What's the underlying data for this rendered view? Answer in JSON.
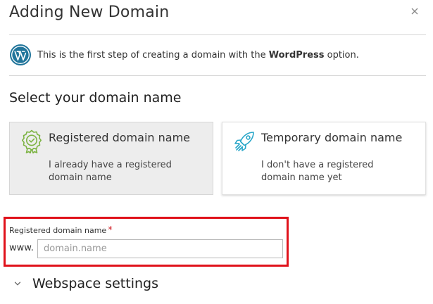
{
  "dialog": {
    "title": "Adding New Domain",
    "close_label": "×"
  },
  "info": {
    "text_before": "This is the first step of creating a domain with the ",
    "text_bold": "WordPress",
    "text_after": " option.",
    "icon": "wordpress-icon"
  },
  "section": {
    "title": "Select your domain name"
  },
  "options": [
    {
      "title": "Registered domain name",
      "description": "I already have a registered domain name",
      "icon": "award-badge-icon",
      "selected": true
    },
    {
      "title": "Temporary domain name",
      "description": "I don't have a registered domain name yet",
      "icon": "rocket-icon",
      "selected": false
    }
  ],
  "field": {
    "label": "Registered domain name",
    "required_mark": "*",
    "prefix": "www.",
    "placeholder": "domain.name",
    "value": ""
  },
  "webspace": {
    "title": "Webspace settings",
    "icon": "chevron-down-icon"
  },
  "colors": {
    "highlight_border": "#e0121b",
    "required": "#d01c24",
    "selected_card_bg": "#ededed",
    "wordpress_blue": "#21759b",
    "award_green": "#7cb342",
    "rocket_blue": "#2aa7c9"
  }
}
